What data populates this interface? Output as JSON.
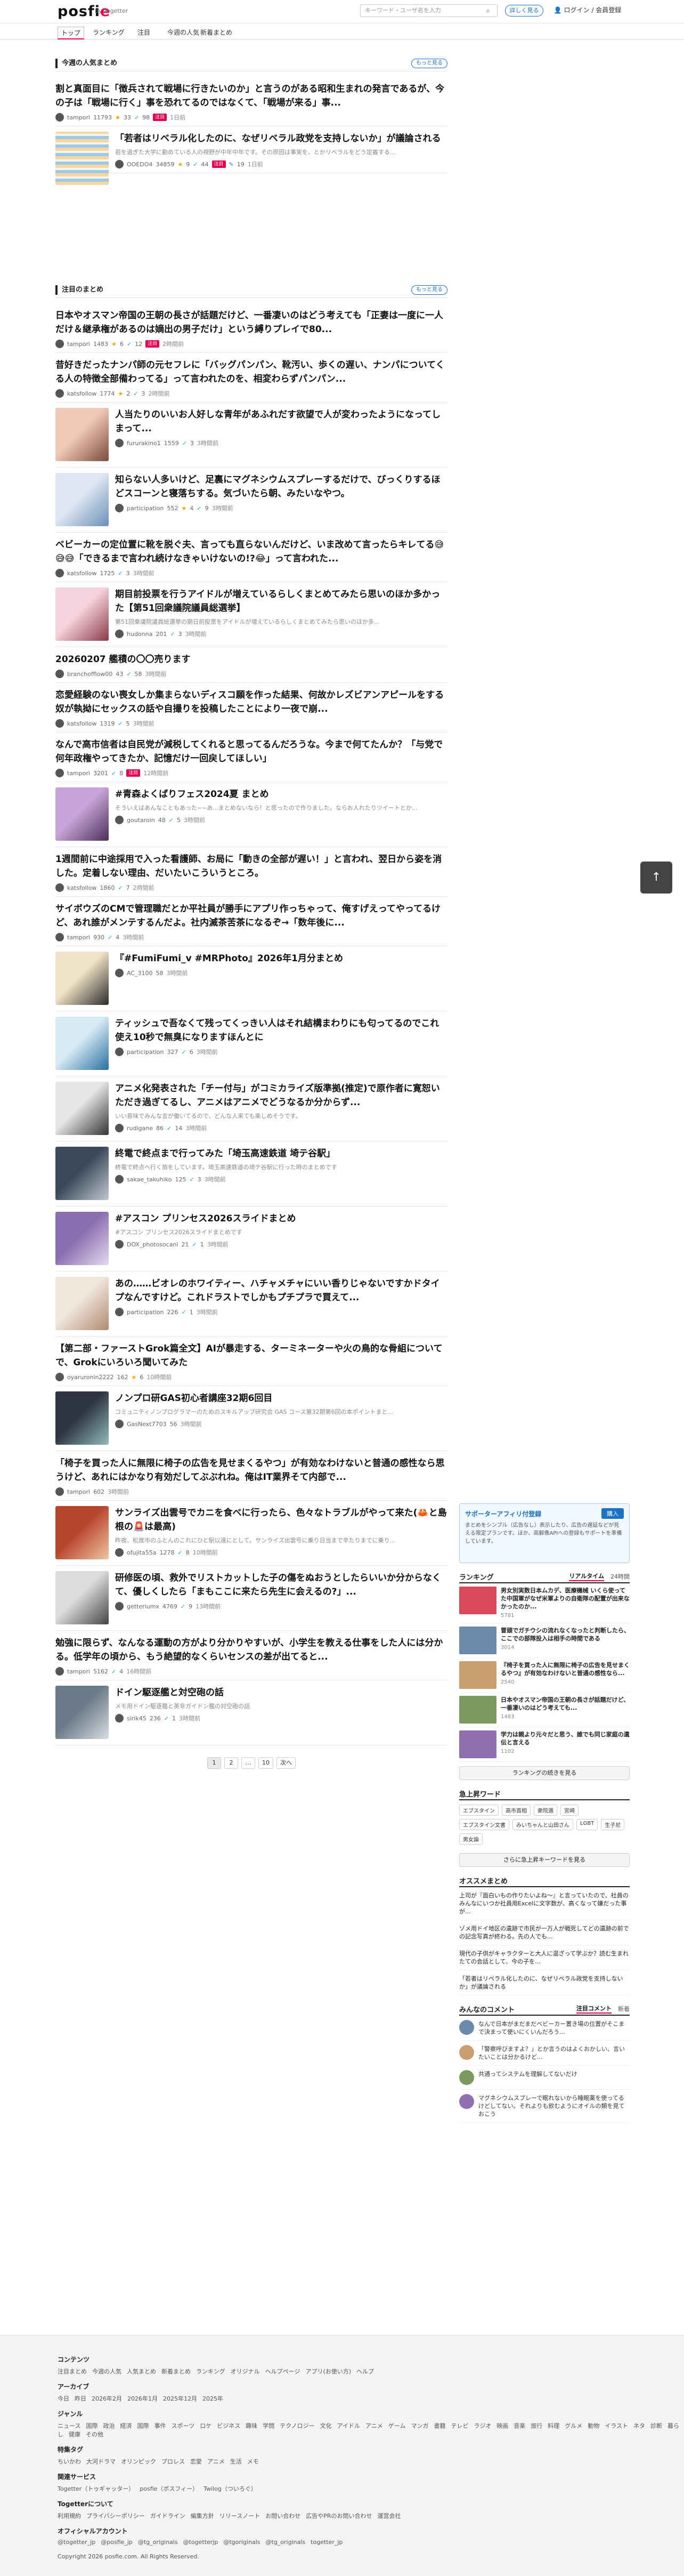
{
  "header": {
    "logo_text": "posfi",
    "logo_e": "e",
    "by_text": "by Togetter",
    "search_placeholder": "キーワード・ユーザ名を入力",
    "details_label": "詳しく見る",
    "login_label": "ログイン / 会員登録"
  },
  "nav": [
    "トップ",
    "ランキング",
    "注目",
    "今週の人気",
    "新着まとめ"
  ],
  "popular": {
    "heading": "今週の人気まとめ",
    "more_label": "もっと見る",
    "items": [
      {
        "title": "割と真面目に「徴兵されて戦場に行きたいのか」と言うのがある昭和生まれの発言であるが、今の子は「戦場に行く」事を恐れてるのではなくて、「戦場が来る」事...",
        "user": "tampori",
        "views": "11793",
        "stars": "33",
        "tweets": "98",
        "badge": "注目",
        "ago": "1日前"
      },
      {
        "title": "「若者はリベラル化したのに、なぜリベラル政党を支持しないか」が議論される",
        "desc": "若を過ぎた大学に勤めている人の視野が中年中年です。その原因は事実を、とかリベラルをどう定義する...",
        "user": "OOEDO4",
        "views": "34859",
        "stars": "9",
        "tweets": "44",
        "badge": "注目",
        "extra": "19",
        "ago": "1日前"
      }
    ]
  },
  "trending": {
    "heading": "注目のまとめ",
    "more_label": "もっと見る",
    "items": [
      {
        "title": "日本やオスマン帝国の王朝の長さが話題だけど、一番凄いのはどう考えても「正妻は一度に一人だけ＆継承権があるのは嫡出の男子だけ」という縛りプレイで80...",
        "user": "tampori",
        "views": "1483",
        "stars": "6",
        "tweets": "12",
        "badge": "注目",
        "ago": "2時間前",
        "img": false
      },
      {
        "title": "昔好きだったナンパ師の元セフレに「バッグパンパン、靴汚い、歩くの遅い、ナンパについてくる人の特徴全部備わってる」って言われたのを、相変わらずパンパン...",
        "user": "katsfollow",
        "views": "1774",
        "stars": "2",
        "tweets": "3",
        "ago": "2時間前",
        "img": false
      },
      {
        "title": "人当たりのいいお人好しな青年があふれだす欲望で人が変わったようになってしまって...",
        "user": "fururakino1",
        "views": "1559",
        "stars": "",
        "tweets": "3",
        "ago": "3時間前",
        "img": true,
        "c1": "#f2c9b8",
        "c2": "#7b4a3d"
      },
      {
        "title": "知らない人多いけど、足裏にマグネシウムスプレーするだけで、びっくりするほどスコーンと寝落ちする。気づいたら朝、みたいなやつ。",
        "user": "participation",
        "views": "552",
        "stars": "4",
        "tweets": "9",
        "ago": "3時間前",
        "img": true,
        "c1": "#dfe8f2",
        "c2": "#6a8fb8"
      },
      {
        "title": "ベビーカーの定位置に靴を脱ぐ夫、言っても直らないんだけど、いま改めて言ったらキレてる😅😅😅「できるまで言われ続けなきゃいけないの!?😂」って言われた...",
        "user": "katsfollow",
        "views": "1725",
        "stars": "",
        "tweets": "3",
        "ago": "3時間前",
        "img": false
      },
      {
        "title": "期目前投票を行うアイドルが増えているらしくまとめてみたら思いのほか多かった【第51回衆議院議員総選挙】",
        "desc": "第51回衆議院議員総選挙の期日前投票をアイドルが増えているらしくまとめてみたら思いのほか多...",
        "user": "hudonna",
        "views": "201",
        "stars": "",
        "tweets": "3",
        "ago": "3時間前",
        "img": true,
        "c1": "#f6d3dc",
        "c2": "#8a3a4a"
      },
      {
        "title": "20260207 艦積の〇〇売ります",
        "user": "branchofflow00",
        "views": "43",
        "stars": "",
        "tweets": "58",
        "ago": "3時間前",
        "img": false
      },
      {
        "title": "恋愛経験のない喪女しか集まらないディスコ願を作った結果、何故かレズビアンアピールをする奴が執拗にセックスの話や自撮りを投稿したことにより一夜で崩...",
        "user": "katsfollow",
        "views": "1319",
        "stars": "",
        "tweets": "5",
        "ago": "3時間前",
        "img": false
      },
      {
        "title": "なんで高市信者は自民党が減税してくれると思ってるんだろうな。今まで何てたんか？「与党で何年政権やってきたか、記憶だけ一回戻してほしい」",
        "user": "tampori",
        "views": "3201",
        "stars": "",
        "tweets": "8",
        "badge": "注目",
        "ago": "12時間前",
        "img": false
      },
      {
        "title": "#青森よくばりフェス2024夏 まとめ",
        "desc": "そういえばあんなこともあった~~あ...まとめないなら！と思ったので作りました。ならお人れたりツイートとか...",
        "user": "goutaroin",
        "views": "48",
        "stars": "",
        "tweets": "5",
        "ago": "3時間前",
        "img": true,
        "c1": "#c7a5d9",
        "c2": "#4a3059"
      },
      {
        "title": "1週間前に中途採用で入った看護師、お局に「動きの全部が遅い！」と言われ、翌日から姿を消した。定着しない理由、だいたいこういうところ。",
        "user": "katsfollow",
        "views": "1860",
        "stars": "",
        "tweets": "7",
        "ago": "2時間前",
        "img": false
      },
      {
        "title": "サイボウズのCMで管理職だとか平社員が勝手にアプリ作っちゃって、俺すげえってやってるけど、あれ誰がメンテするんだよ。社内滅茶苦茶になるぞ→「数年後に...",
        "user": "tampori",
        "views": "930",
        "stars": "",
        "tweets": "4",
        "ago": "3時間前",
        "img": false
      },
      {
        "title": "『#FumiFumi_v #MRPhoto』2026年1月分まとめ",
        "user": "AC_3100",
        "views": "58",
        "stars": "",
        "tweets": "",
        "ago": "3時間前",
        "img": true,
        "c1": "#f1e3c7",
        "c2": "#2b2b2b"
      },
      {
        "title": "ティッシュで吾なくて残ってくっきい人はそれ結構まわりにも匂ってるのでこれ使え10秒で無臭になりますほんとに",
        "user": "participation",
        "views": "327",
        "stars": "",
        "tweets": "6",
        "ago": "3時間前",
        "img": true,
        "c1": "#d8ecf6",
        "c2": "#2a6fa0"
      },
      {
        "title": "アニメ化発表された「チー付与」がコミカライズ版準拠(推定)で原作者に寛恕いただき過ぎてるし、アニメはアニメでどうなるか分からず...",
        "desc": "いい意味でみんな言が働いてるので、どんな人来ても楽しめそうです。",
        "user": "rudigane",
        "views": "86",
        "stars": "",
        "tweets": "14",
        "ago": "3時間前",
        "img": true,
        "c1": "#e6e6e6",
        "c2": "#333333"
      },
      {
        "title": "終電で終点まで行ってみた「埼玉高速鉄道 埼テ谷駅」",
        "desc": "終電で終点へ行く旅をしています。埼玉高速鉄道の埼テ谷駅に行った時のまとめです",
        "user": "sakae_takuhiko",
        "views": "125",
        "stars": "",
        "tweets": "3",
        "ago": "3時間前",
        "img": true,
        "c1": "#3a4a5a",
        "c2": "#c0c8d0"
      },
      {
        "title": "#アスコン プリンセス2026スライドまとめ",
        "desc": "#アスコン プリンセス2026スライドまとめです",
        "user": "DOX_photosocanl",
        "views": "21",
        "stars": "",
        "tweets": "1",
        "ago": "3時間前",
        "img": true,
        "c1": "#8a6fb0",
        "c2": "#e4d8f0"
      },
      {
        "title": "あの……ビオレのホワイティー、ハチャメチャにいい香りじゃないですかドタイプなんですけど。これドラストでしかもプチプラで買えて...",
        "user": "participation",
        "views": "226",
        "stars": "",
        "tweets": "1",
        "ago": "3時間前",
        "img": true,
        "c1": "#f0e6dc",
        "c2": "#b08a70"
      },
      {
        "title": "【第二部・ファーストGrok篇全文】AIが暴走する、ターミネーターや火の鳥的な骨組についてで、Grokにいろいろ聞いてみた",
        "user": "oyaruronin2222",
        "views": "162",
        "stars": "6",
        "tweets": "",
        "ago": "10時間前",
        "img": false
      },
      {
        "title": "ノンプロ研GAS初心者講座32期6回目",
        "desc": "コミュニティノンプログラマーのためのスキルアップ研究会 GAS コース第32期第6回の本ポイントまと...",
        "user": "GasNext7703",
        "views": "56",
        "stars": "",
        "tweets": "",
        "ago": "3時間前",
        "img": true,
        "c1": "#2e3440",
        "c2": "#8fbcbb"
      },
      {
        "title": "「椅子を買った人に無限に椅子の広告を見せまくるやつ」が有効なわけないと普通の感性なら思うけど、あれにはかなり有効だしてぶぶれね。俺はIT業界そて内部で...",
        "user": "tampori",
        "views": "602",
        "stars": "",
        "tweets": "",
        "ago": "3時間前",
        "img": false
      },
      {
        "title": "サンライズ出雲号でカニを食べに行ったら、色々なトラブルがやって来た(🦀と島根の🚨は最高)",
        "desc": "昨夜、松度市のふとんのこれにひと駅以遠にとして。サンライズ出雲号に乗り日当まで辛たりまでに乗り...",
        "user": "ofujita55a",
        "views": "1278",
        "stars": "",
        "tweets": "8",
        "ago": "10時間前",
        "img": true,
        "c1": "#b7452e",
        "c2": "#f1c6a0"
      },
      {
        "title": "研修医の頃、救外でリストカットした子の傷をぬおうとしたらいいか分からなくて、優しくしたら「まもここに来たら先生に会えるの?」...",
        "user": "getteriumx",
        "views": "4769",
        "stars": "",
        "tweets": "9",
        "ago": "13時間前",
        "img": true,
        "c1": "#dcdcdc",
        "c2": "#444444"
      },
      {
        "title": "勉強に限らず、なんなる運動の方がより分かりやすいが、小学生を教える仕事をした人には分かる。低学年の頃から、もう絶望的なくらいセンスの差が出てると...",
        "user": "tampori",
        "views": "5162",
        "stars": "",
        "tweets": "4",
        "ago": "16時間前",
        "img": false
      },
      {
        "title": "ドイン駆逐艦と対空砲の話",
        "desc": "メモ用ドイン駆逐艦と英非ガイドン艦の対空砲の話",
        "user": "sirik45",
        "views": "236",
        "stars": "",
        "tweets": "1",
        "ago": "3時間前",
        "img": true,
        "c1": "#6b7a88",
        "c2": "#d7dde2"
      }
    ]
  },
  "pager": {
    "pages": [
      "1",
      "2",
      "…",
      "10"
    ],
    "next": "次へ"
  },
  "sidebar": {
    "promo_head": "サポーターアフィリ付登録",
    "promo_text": "まとめをシンプル（広告なし）表示したり、広告の遅延などが見える限定プランです。ほか、高解像APIへの登録もサポートを準備しています。",
    "promo_join": "購入",
    "ranking_title": "ランキング",
    "ranking_tabs": [
      "リアルタイム",
      "24時間"
    ],
    "ranking": [
      {
        "text": "男女別実数日本ムカデ、医療機械 いくら使ってた中国軍がなぜ米軍よりの自衛隊の配置が出来なかったのか...",
        "meta": "5781",
        "c": "#d84a5a"
      },
      {
        "text": "冒頭でガチウシの流れなくなったと判断したら、ここでの部隊投入は相手の時間である",
        "meta": "3014",
        "c": "#6a8aa8"
      },
      {
        "text": "『椅子を買った人に無限に椅子の広告を見せまくるやつ』が有効なわけないと普通の感性なら...",
        "meta": "2540",
        "c": "#c8a070"
      },
      {
        "text": "日本やオスマン帝国の王朝の長さが話題だけど、一番凄いのはどう考えても...",
        "meta": "1483",
        "c": "#7a9a60"
      },
      {
        "text": "学力は親より元々だと思う、誰でも同じ家庭の遺伝と言える",
        "meta": "1102",
        "c": "#9070b0"
      }
    ],
    "ranking_more": "ランキングの続きを見る",
    "keywords_title": "急上昇ワード",
    "keywords": [
      "エプスタイン",
      "高市首相",
      "衆院選",
      "宮崎",
      "エプスタイン文書",
      "みいちゃんと山田さん",
      "LGBT",
      "生子尼",
      "男女論"
    ],
    "keywords_more": "さらに急上昇キーワードを見る",
    "recommend_title": "オススメまとめ",
    "recommend": [
      "上司が『面白いもの作りたいよね～』と言っていたので、社員のみんなにいつか社員用Excelに文字数が、高くなって嫌だった事が...",
      "ゾメ用ドイ地区の遺跡で市民が一万人が戦死してどの遺跡の前での記念写真が終わる。先の人でも...",
      "現代の子供がキャラクターと大人に混ざって学ぶか？読む生まれたての会話として、今の子を...",
      "「若者はリベラル化したのに、なぜリベラル政党を支持しないか」が議論される"
    ],
    "comments_title": "みんなのコメント",
    "comment_tabs": [
      "注目コメント",
      "新着"
    ],
    "comments": [
      "なんで日本がまだまだベビーカー置き場の位置がそこまで決まって使いにくいんだろう...",
      "「警察呼びますよ？」とか言うのはよくおかしい、言いたいことは分かるけど...",
      "共通ってシステムを理解してないだけ",
      "マグネシウムスプレーで眠れないから睡眠薬を使ってるけどしてない。それよりも飲むようにオイルの類を見ておこう"
    ]
  },
  "footer": {
    "sections": [
      {
        "head": "コンテンツ",
        "links": [
          "注目まとめ",
          "今週の人気",
          "人気まとめ",
          "新着まとめ",
          "ランキング",
          "オリジナル",
          "ヘルプページ",
          "アプリ(お使い方)",
          "ヘルプ"
        ]
      },
      {
        "head": "アーカイブ",
        "links": [
          "今日",
          "昨日",
          "2026年2月",
          "2026年1月",
          "2025年12月",
          "2025年"
        ]
      },
      {
        "head": "ジャンル",
        "links": [
          "ニュース",
          "国際",
          "政治",
          "経済",
          "国際",
          "事件",
          "スポーツ",
          "ロケ",
          "ビジネス",
          "趣味",
          "学問",
          "テクノロジー",
          "文化",
          "アイドル",
          "アニメ",
          "ゲーム",
          "マンガ",
          "書籍",
          "テレビ",
          "ラジオ",
          "映画",
          "音楽",
          "旅行",
          "料理",
          "グルメ",
          "動物",
          "イラスト",
          "ネタ",
          "診断",
          "暮らし",
          "健康",
          "その他"
        ]
      },
      {
        "head": "特集タグ",
        "links": [
          "ちいかわ",
          "大河ドラマ",
          "オリンピック",
          "プロレス",
          "恋愛",
          "アニメ",
          "生活",
          "メモ"
        ]
      },
      {
        "head": "関連サービス",
        "links": [
          "Togetter（トゥギャッター）",
          "posfie（ポスフィー）",
          "Twilog（ついろぐ）"
        ]
      },
      {
        "head": "Togetterについて",
        "links": [
          "利用規約",
          "プライバシーポリシー",
          "ガイドライン",
          "編集方針",
          "リリースノート",
          "お問い合わせ",
          "広告やPRのお問い合わせ",
          "運営会社"
        ]
      },
      {
        "head": "オフィシャルアカウント",
        "links": [
          "@togetter_jp",
          "@posfie_jp",
          "@tg_originals",
          "@togetterjp",
          "@tgoriginals",
          "@tg_originals",
          "togetter_jp"
        ]
      }
    ],
    "copyright": "Copyright 2026 posfie.com. All Rights Reserved."
  },
  "to_top": "↑"
}
